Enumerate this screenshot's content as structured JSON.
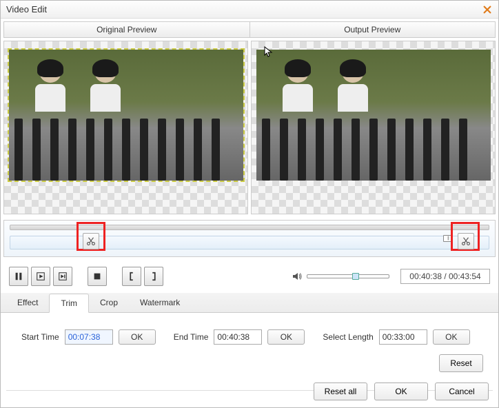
{
  "window": {
    "title": "Video Edit"
  },
  "preview": {
    "original_label": "Original Preview",
    "output_label": "Output Preview"
  },
  "timeline": {
    "time_display": "00:40:38 / 00:43:54"
  },
  "tabs": {
    "effect": "Effect",
    "trim": "Trim",
    "crop": "Crop",
    "watermark": "Watermark"
  },
  "trim": {
    "start_label": "Start Time",
    "start_value": "00:07:38",
    "end_label": "End Time",
    "end_value": "00:40:38",
    "select_label": "Select Length",
    "select_value": "00:33:00",
    "ok": "OK",
    "reset": "Reset"
  },
  "buttons": {
    "reset_all": "Reset all",
    "ok": "OK",
    "cancel": "Cancel"
  }
}
